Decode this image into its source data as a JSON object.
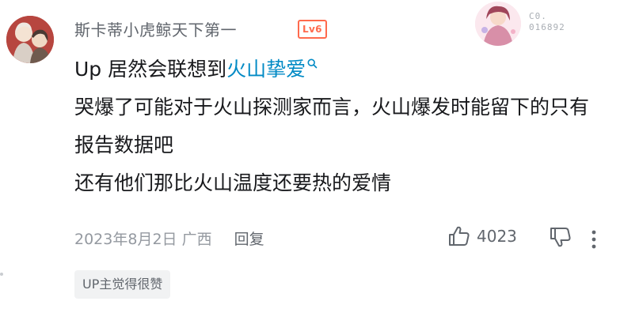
{
  "comment": {
    "username": "斯卡蒂小虎鲸天下第一",
    "level": "Lv6",
    "decoration_code": "C0.\n016892",
    "content_prefix": "Up 居然会联想到",
    "link_text": "火山挚爱",
    "lines": [
      "哭爆了可能对于火山探测家而言，火山爆发时能留下的只有报告数据吧",
      "还有他们那比火山温度还要热的爱情"
    ],
    "date": "2023年8月2日",
    "location": "广西",
    "reply_label": "回复",
    "like_count": "4023",
    "up_badge": "UP主觉得很赞"
  },
  "colors": {
    "link": "#008ac5",
    "level_badge": "#ff6a4d",
    "meta": "#9499a0"
  },
  "icons": [
    "avatar",
    "search-icon",
    "thumbs-up-icon",
    "thumbs-down-icon",
    "more-icon"
  ]
}
